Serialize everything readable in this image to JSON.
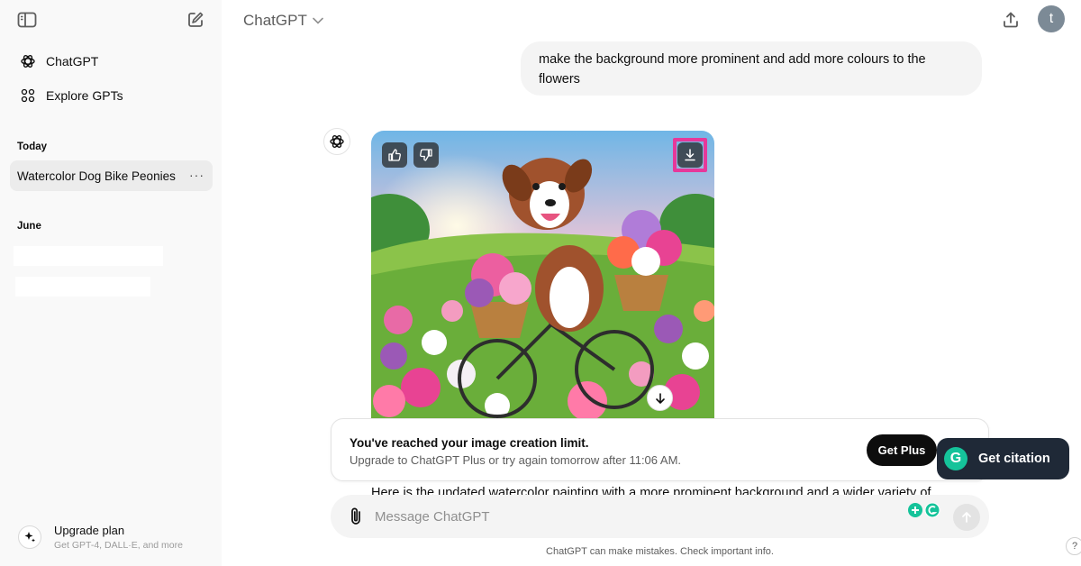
{
  "sidebar": {
    "nav": [
      {
        "label": "ChatGPT",
        "icon": "openai-logo-icon"
      },
      {
        "label": "Explore GPTs",
        "icon": "grid-icon"
      }
    ],
    "sections": [
      {
        "label": "Today",
        "items": [
          {
            "label": "Watercolor Dog Bike Peonies",
            "more": "···"
          }
        ]
      },
      {
        "label": "June",
        "items": []
      }
    ],
    "upgrade": {
      "title": "Upgrade plan",
      "subtitle": "Get GPT-4, DALL·E, and more"
    }
  },
  "header": {
    "model": "ChatGPT",
    "avatar_initial": "t"
  },
  "conversation": {
    "user_message": "make the background more prominent and add more colours to the flowers",
    "assistant_partial": "Here is the updated watercolor painting with a more prominent background and a wider variety of"
  },
  "limit_banner": {
    "title": "You've reached your image creation limit.",
    "subtitle": "Upgrade to ChatGPT Plus or try again tomorrow after 11:06 AM.",
    "button": "Get Plus"
  },
  "citation": {
    "label": "Get citation",
    "logo": "G"
  },
  "composer": {
    "placeholder": "Message ChatGPT"
  },
  "footer": {
    "disclaimer": "ChatGPT can make mistakes. Check important info.",
    "help": "?"
  },
  "colors": {
    "accent_highlight": "#e6389a",
    "citation_bg": "#1f2937",
    "grammarly": "#15c39a"
  }
}
